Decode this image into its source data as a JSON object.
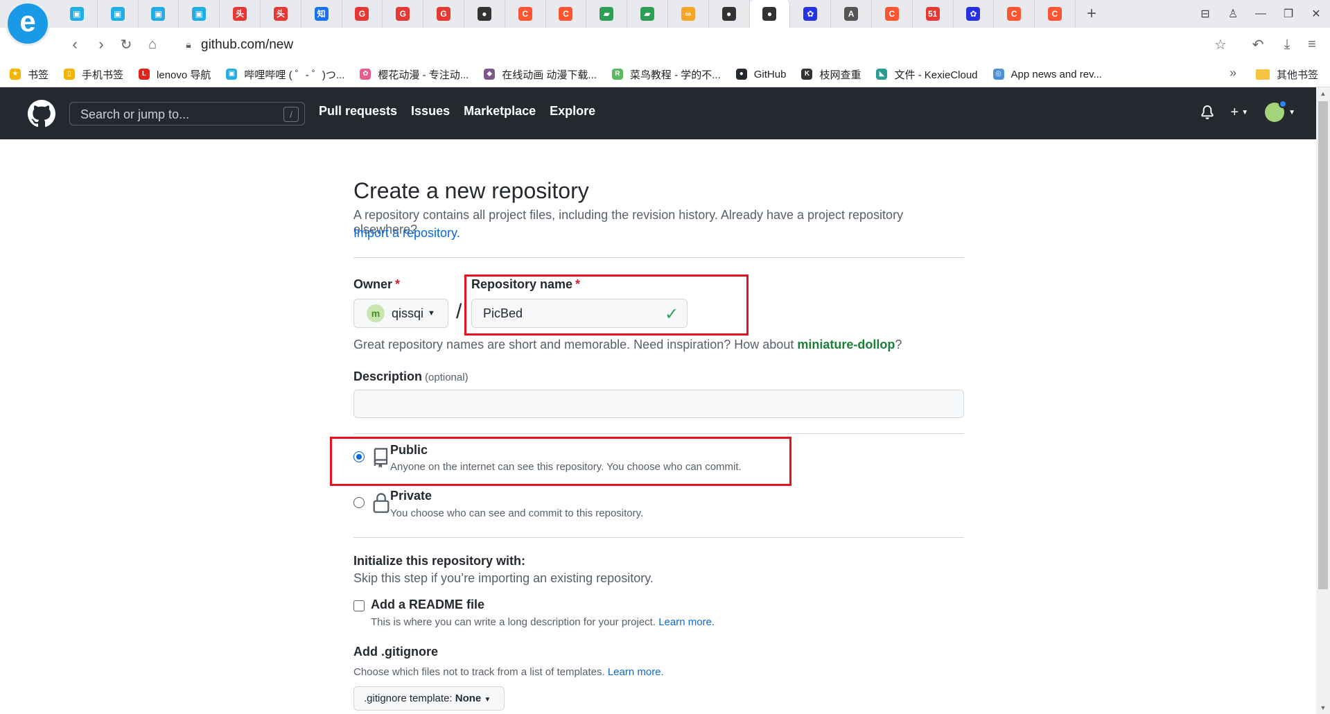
{
  "browser": {
    "url": "github.com/new",
    "tabs": [
      {
        "icon": "bilibili-icon",
        "color": "#23ade5",
        "glyph": "▣"
      },
      {
        "icon": "bilibili-icon",
        "color": "#23ade5",
        "glyph": "▣"
      },
      {
        "icon": "bilibili-icon",
        "color": "#23ade5",
        "glyph": "▣"
      },
      {
        "icon": "bilibili-icon",
        "color": "#23ade5",
        "glyph": "▣"
      },
      {
        "icon": "toutiao-icon",
        "color": "#e53935",
        "glyph": "头"
      },
      {
        "icon": "toutiao-icon",
        "color": "#e53935",
        "glyph": "头"
      },
      {
        "icon": "zhihu-icon",
        "color": "#1772f6",
        "glyph": "知"
      },
      {
        "icon": "google-g-icon",
        "color": "#e53935",
        "glyph": "G"
      },
      {
        "icon": "google-g-icon",
        "color": "#e53935",
        "glyph": "G"
      },
      {
        "icon": "google-g-icon",
        "color": "#e53935",
        "glyph": "G"
      },
      {
        "icon": "github-icon",
        "color": "#333333",
        "glyph": "●"
      },
      {
        "icon": "csdn-icon",
        "color": "#fc5531",
        "glyph": "C"
      },
      {
        "icon": "csdn-icon",
        "color": "#fc5531",
        "glyph": "C"
      },
      {
        "icon": "book-icon",
        "color": "#2e9e55",
        "glyph": "▰"
      },
      {
        "icon": "book-icon",
        "color": "#2e9e55",
        "glyph": "▰"
      },
      {
        "icon": "infinity-icon",
        "color": "#f5a623",
        "glyph": "∞"
      },
      {
        "icon": "github-icon",
        "color": "#333333",
        "glyph": "●"
      },
      {
        "icon": "github-icon",
        "color": "#333333",
        "glyph": "●",
        "active": true
      },
      {
        "icon": "baidu-icon",
        "color": "#2932e1",
        "glyph": "✿"
      },
      {
        "icon": "translate-icon",
        "color": "#555555",
        "glyph": "A"
      },
      {
        "icon": "csdn-icon",
        "color": "#fc5531",
        "glyph": "C"
      },
      {
        "icon": "51cto-icon",
        "color": "#e53935",
        "glyph": "51"
      },
      {
        "icon": "baidu-icon",
        "color": "#2932e1",
        "glyph": "✿"
      },
      {
        "icon": "csdn-icon",
        "color": "#fc5531",
        "glyph": "C"
      },
      {
        "icon": "csdn-icon",
        "color": "#fc5531",
        "glyph": "C"
      }
    ],
    "bookmarks": [
      {
        "label": "书签",
        "icon": "star-icon",
        "color": "#f4b400",
        "glyph": "★"
      },
      {
        "label": "手机书签",
        "icon": "phone-icon",
        "color": "#f4b400",
        "glyph": "▯"
      },
      {
        "label": "lenovo 导航",
        "icon": "lenovo-icon",
        "color": "#e2231a",
        "glyph": "L"
      },
      {
        "label": "哔哩哔哩 ( ゜- ゜)つ...",
        "icon": "bilibili-icon",
        "color": "#23ade5",
        "glyph": "▣"
      },
      {
        "label": "樱花动漫 - 专注动...",
        "icon": "sakura-icon",
        "color": "#e85d8a",
        "glyph": "✿"
      },
      {
        "label": "在线动画 动漫下载...",
        "icon": "anime-icon",
        "color": "#7a5a8a",
        "glyph": "◆"
      },
      {
        "label": "菜鸟教程 - 学的不...",
        "icon": "runoob-icon",
        "color": "#5cb85c",
        "glyph": "R"
      },
      {
        "label": "GitHub",
        "icon": "github-icon",
        "color": "#24292f",
        "glyph": "●"
      },
      {
        "label": "枝网查重",
        "icon": "asoul-icon",
        "color": "#333333",
        "glyph": "K"
      },
      {
        "label": "文件 - KexieCloud",
        "icon": "cloud-icon",
        "color": "#2a9d8f",
        "glyph": "◣"
      },
      {
        "label": "App news and rev...",
        "icon": "appnews-icon",
        "color": "#4a90d9",
        "glyph": "◎"
      }
    ],
    "bookmarks_more": "»",
    "other_bookmarks": "其他书签"
  },
  "github": {
    "search_placeholder": "Search or jump to...",
    "search_shortcut": "/",
    "nav": [
      "Pull requests",
      "Issues",
      "Marketplace",
      "Explore"
    ]
  },
  "form": {
    "title": "Create a new repository",
    "subtitle": "A repository contains all project files, including the revision history. Already have a project repository elsewhere?",
    "import_link": "Import a repository.",
    "owner_label": "Owner",
    "owner_name": "qissqi",
    "repo_label": "Repository name",
    "required_mark": "*",
    "repo_value": "PicBed",
    "hint_prefix": "Great repository names are short and memorable. Need inspiration? How about ",
    "hint_name": "miniature-dollop",
    "hint_suffix": "?",
    "desc_label": "Description",
    "desc_optional": "(optional)",
    "visibility": {
      "public_title": "Public",
      "public_desc": "Anyone on the internet can see this repository. You choose who can commit.",
      "private_title": "Private",
      "private_desc": "You choose who can see and commit to this repository.",
      "selected": "Public"
    },
    "init_title": "Initialize this repository with:",
    "init_sub": "Skip this step if you’re importing an existing repository.",
    "readme_title": "Add a README file",
    "readme_checked": false,
    "readme_desc": "This is where you can write a long description for your project.",
    "learn_more": "Learn more.",
    "gitignore_title": "Add .gitignore",
    "gitignore_desc": "Choose which files not to track from a list of templates.",
    "gitignore_btn_prefix": ".gitignore template:",
    "gitignore_btn_value": "None"
  }
}
